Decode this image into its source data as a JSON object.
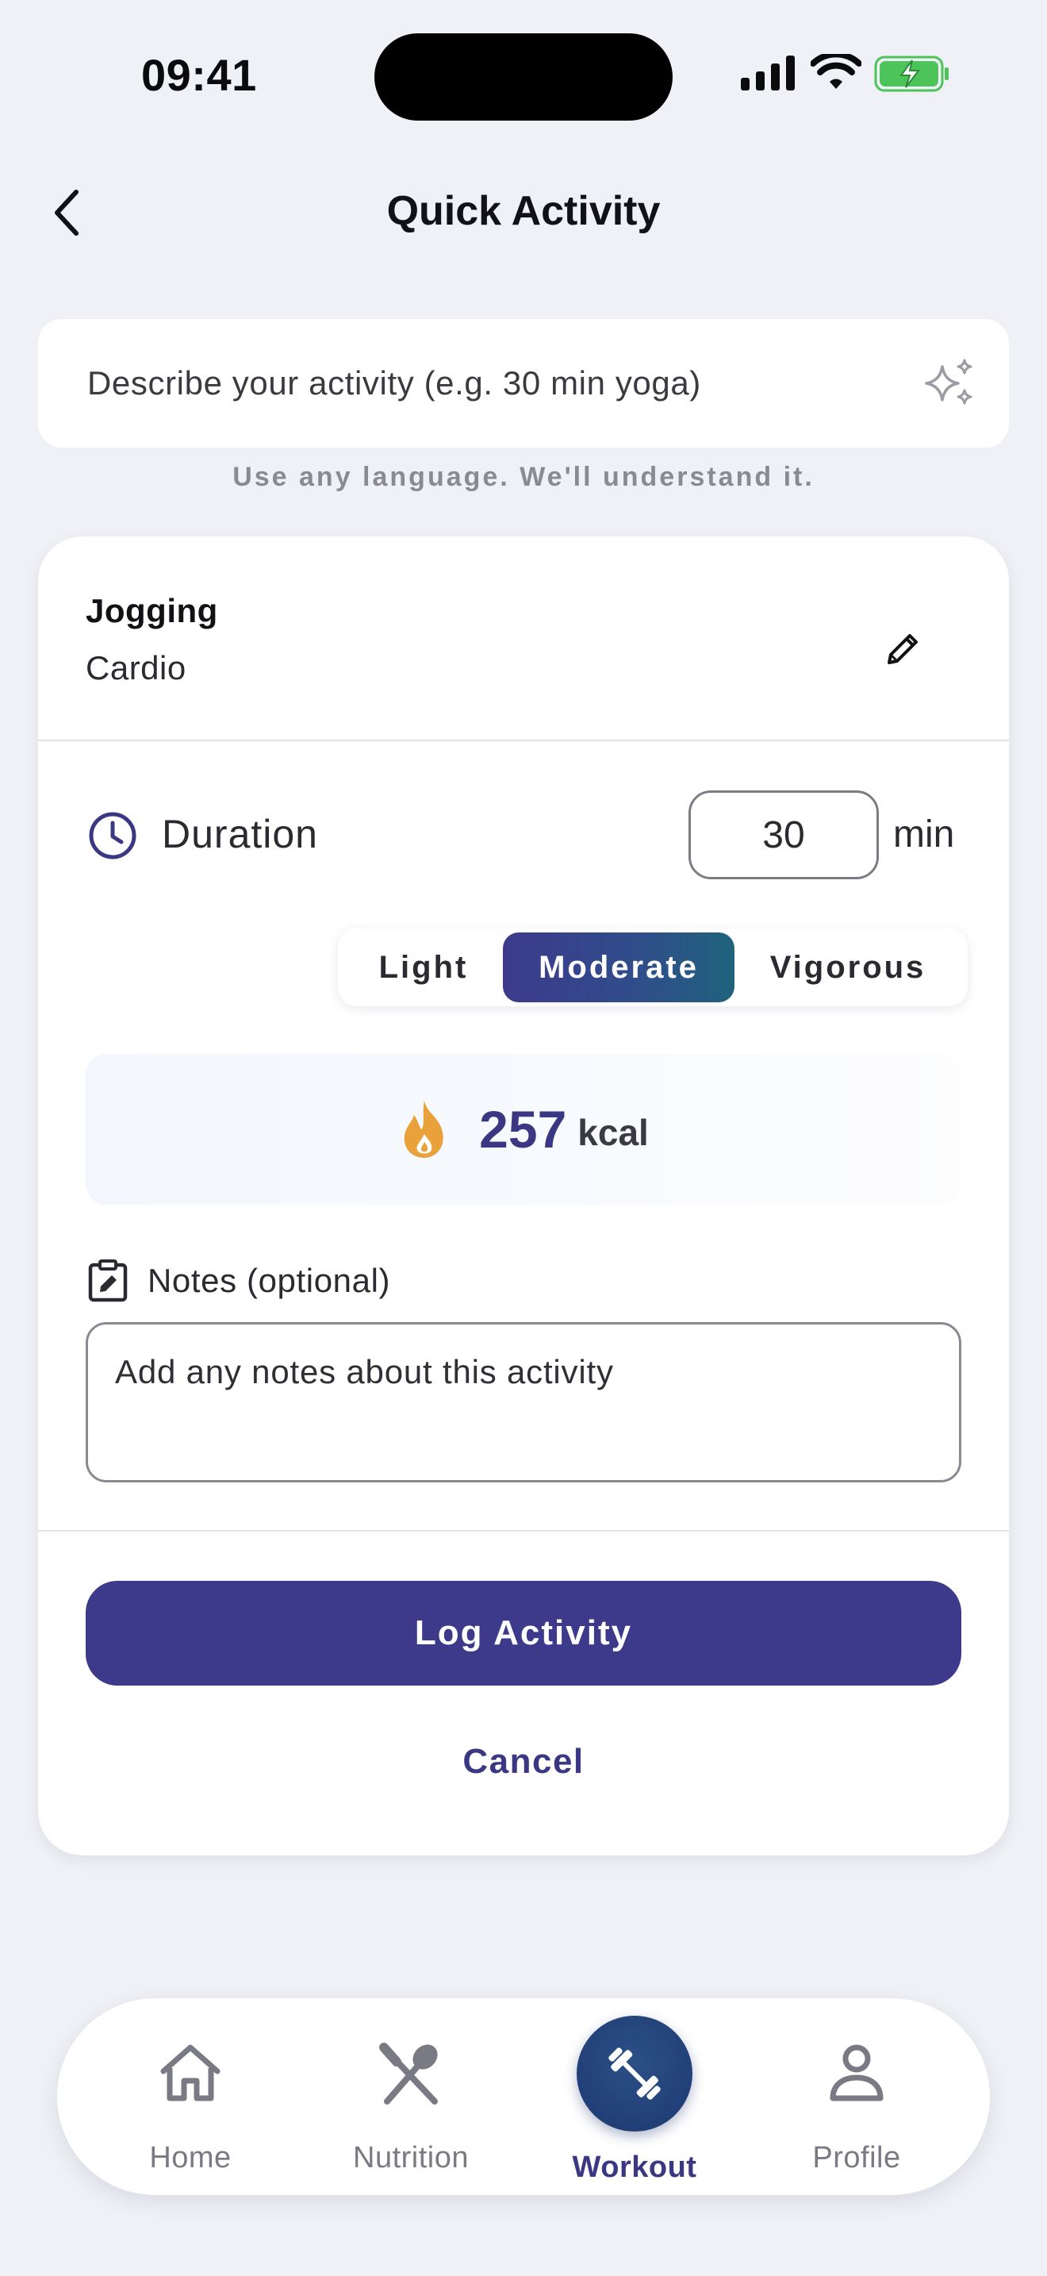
{
  "status_bar": {
    "time": "09:41"
  },
  "header": {
    "title": "Quick Activity"
  },
  "description": {
    "placeholder": "Describe your activity (e.g. 30 min yoga)",
    "hint": "Use any language. We'll understand it."
  },
  "activity": {
    "name": "Jogging",
    "category": "Cardio"
  },
  "duration": {
    "label": "Duration",
    "value": "30",
    "unit": "min"
  },
  "intensity": {
    "options": [
      "Light",
      "Moderate",
      "Vigorous"
    ],
    "selected": "Moderate"
  },
  "calories": {
    "value": "257",
    "unit": "kcal"
  },
  "notes": {
    "label": "Notes (optional)",
    "placeholder": "Add any notes about this activity"
  },
  "actions": {
    "log_label": "Log Activity",
    "cancel_label": "Cancel"
  },
  "nav": {
    "items": [
      {
        "label": "Home",
        "icon": "home-icon"
      },
      {
        "label": "Nutrition",
        "icon": "fork-spoon-icon"
      },
      {
        "label": "Workout",
        "icon": "dumbbell-icon"
      },
      {
        "label": "Profile",
        "icon": "person-icon"
      }
    ],
    "active": "Workout"
  },
  "colors": {
    "primary": "#3d3a8c",
    "accent_gradient_end": "#1f637c",
    "flame": "#e9a23b",
    "background": "#eff1f6"
  }
}
